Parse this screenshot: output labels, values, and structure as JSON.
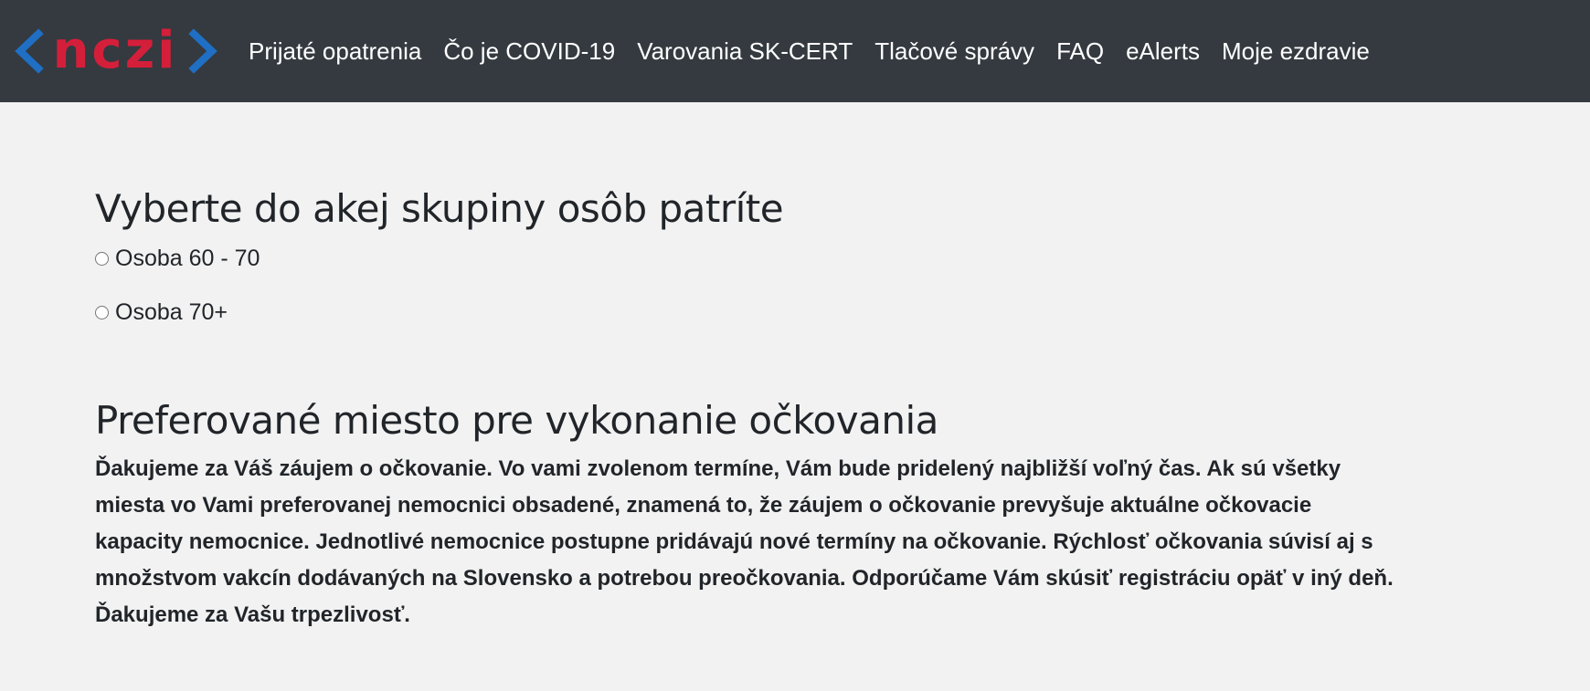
{
  "header": {
    "logo_text": "nczi",
    "colors": {
      "background": "#343a40",
      "logo_red": "#d41f3a",
      "logo_blue": "#1f6fc4"
    },
    "nav": [
      "Prijaté opatrenia",
      "Čo je COVID-19",
      "Varovania SK-CERT",
      "Tlačové správy",
      "FAQ",
      "eAlerts",
      "Moje ezdravie"
    ]
  },
  "group_section": {
    "title": "Vyberte do akej skupiny osôb patríte",
    "options": [
      {
        "label": "Osoba 60 - 70",
        "selected": false
      },
      {
        "label": "Osoba 70+",
        "selected": false
      }
    ]
  },
  "location_section": {
    "title": "Preferované miesto pre vykonanie očkovania",
    "text_lines": [
      "Ďakujeme za Váš záujem o očkovanie. Vo vami zvolenom termíne, Vám bude pridelený najbližší voľný čas. Ak sú všetky",
      "miesta vo Vami preferovanej nemocnici obsadené, znamená to, že záujem o očkovanie prevyšuje aktuálne očkovacie",
      "kapacity nemocnice. Jednotlivé nemocnice postupne pridávajú nové termíny na očkovanie. Rýchlosť očkovania súvisí aj s",
      "množstvom vakcín dodávaných na Slovensko a potrebou preočkovania. Odporúčame Vám skúsiť registráciu opäť v iný deň.",
      "Ďakujeme za Vašu trpezlivosť."
    ]
  }
}
